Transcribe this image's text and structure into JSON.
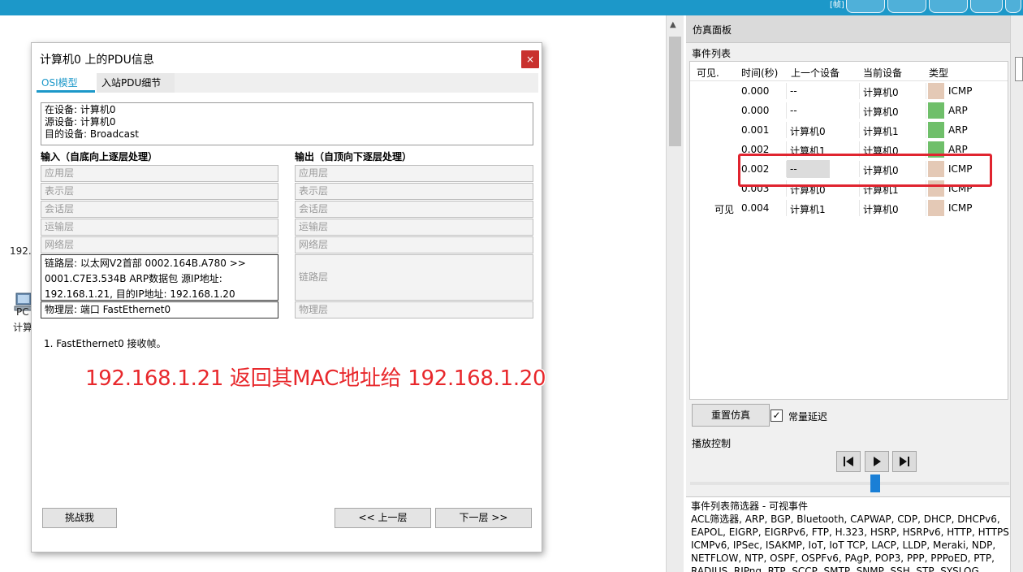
{
  "topbar": {
    "label": "[帧]"
  },
  "workspace": {
    "fragment_ip": "192.1",
    "pc_label": "PC",
    "pc_name": "计算"
  },
  "dialog": {
    "title": "计算机0 上的PDU信息",
    "close": "×",
    "tabs": [
      "OSI模型",
      "入站PDU细节"
    ],
    "info": [
      "在设备: 计算机0",
      "源设备: 计算机0",
      "目的设备: Broadcast"
    ],
    "in_head": "输入（自底向上逐层处理）",
    "out_head": "输出（自顶向下逐层处理）",
    "layers_in": [
      "应用层",
      "表示层",
      "会话层",
      "运输层",
      "网络层"
    ],
    "layers_out": [
      "应用层",
      "表示层",
      "会话层",
      "运输层",
      "网络层"
    ],
    "in_link": [
      "链路层: 以太网V2首部 0002.164B.A780 >>",
      "0001.C7E3.534B ARP数据包 源IP地址:",
      "192.168.1.21, 目的IP地址: 192.168.1.20"
    ],
    "in_physical": "物理层: 端口 FastEthernet0",
    "out_link": "链路层",
    "out_physical": "物理层",
    "step_note": "1. FastEthernet0 接收帧。",
    "annotation": "192.168.1.21 返回其MAC地址给 192.168.1.20",
    "buttons": {
      "challenge": "挑战我",
      "prev": "<< 上一层",
      "next": "下一层 >>"
    }
  },
  "sim": {
    "title": "仿真面板",
    "event_list_label": "事件列表",
    "headers": {
      "visible": "可见.",
      "time": "时间(秒)",
      "last": "上一个设备",
      "current": "当前设备",
      "type": "类型"
    },
    "events": [
      {
        "visible": "",
        "time": "0.000",
        "last": "--",
        "current": "计算机0",
        "type": "ICMP",
        "color": "#e4c9b6"
      },
      {
        "visible": "",
        "time": "0.000",
        "last": "--",
        "current": "计算机0",
        "type": "ARP",
        "color": "#6fbf6a"
      },
      {
        "visible": "",
        "time": "0.001",
        "last": "计算机0",
        "current": "计算机1",
        "type": "ARP",
        "color": "#6fbf6a"
      },
      {
        "visible": "",
        "time": "0.002",
        "last": "计算机1",
        "current": "计算机0",
        "type": "ARP",
        "color": "#6fbf6a"
      },
      {
        "visible": "",
        "time": "0.002",
        "last": "--",
        "current": "计算机0",
        "type": "ICMP",
        "color": "#e4c9b6"
      },
      {
        "visible": "",
        "time": "0.003",
        "last": "计算机0",
        "current": "计算机1",
        "type": "ICMP",
        "color": "#e4c9b6"
      },
      {
        "visible": "可见",
        "time": "0.004",
        "last": "计算机1",
        "current": "计算机0",
        "type": "ICMP",
        "color": "#e4c9b6"
      }
    ],
    "reset_button": "重置仿真",
    "constant_delay": "常量延迟",
    "constant_delay_checked": true,
    "check_mark": "✓",
    "play_label": "播放控制",
    "slider_fraction": 0.58,
    "filter_title": "事件列表筛选器 - 可视事件",
    "filter_text": "ACL筛选器, ARP, BGP, Bluetooth, CAPWAP, CDP, DHCP, DHCPv6, EAPOL, EIGRP, EIGRPv6, FTP, H.323, HSRP, HSRPv6, HTTP, HTTPS, ICMPv6, IPSec, ISAKMP, IoT, IoT TCP, LACP, LLDP, Meraki, NDP, NETFLOW, NTP, OSPF, OSPFv6, PAgP, POP3, PPP, PPPoED, PTP, RADIUS, RIPng, RTP, SCCP, SMTP, SNMP, SSH, STP, SYSLOG, TACACS"
  },
  "colors": {
    "accent": "#1c98c9",
    "highlight": "#e0242f",
    "arp": "#6fbf6a",
    "icmp": "#e4c9b6"
  }
}
